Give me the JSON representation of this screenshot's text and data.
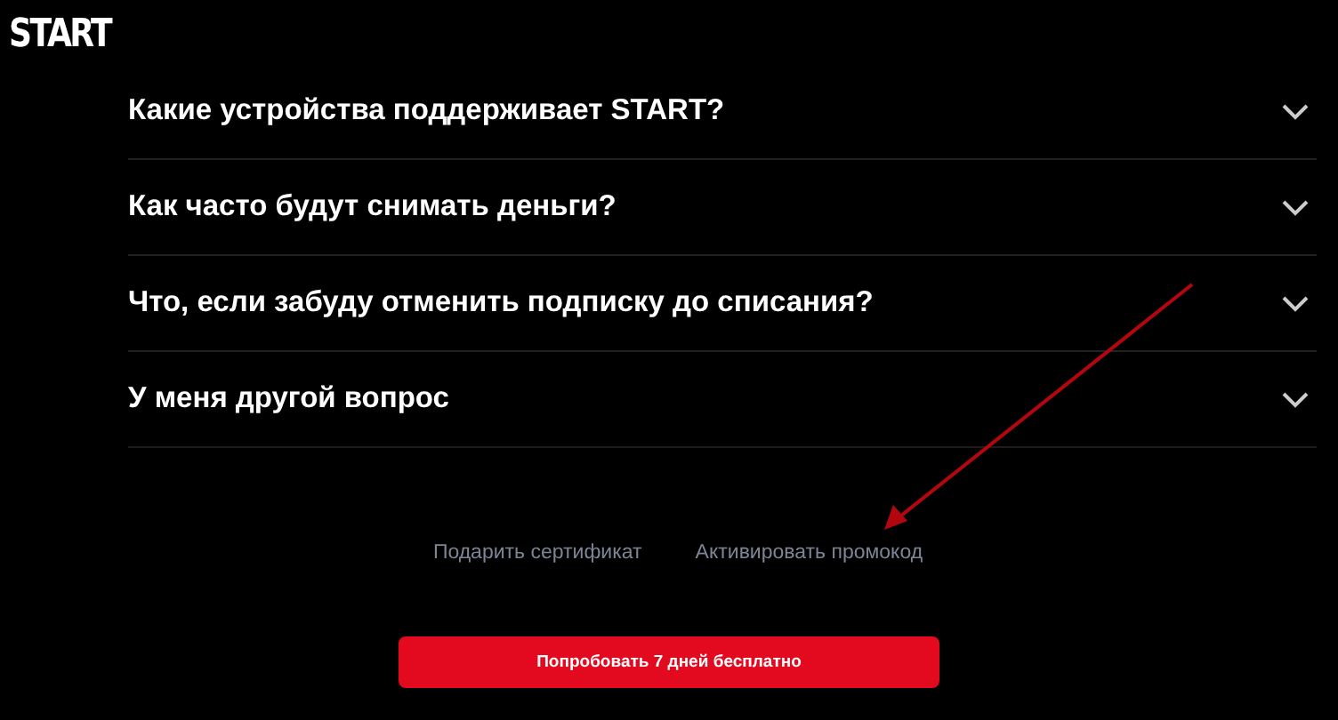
{
  "logo": "START",
  "faq": [
    {
      "question": "Какие устройства поддерживает START?",
      "expanded": false
    },
    {
      "question": "Как часто будут снимать деньги?",
      "expanded": false
    },
    {
      "question": "Что, если забуду отменить подписку до списания?",
      "expanded": false
    },
    {
      "question": "У меня другой вопрос",
      "expanded": false
    }
  ],
  "links": [
    "Подарить сертификат",
    "Активировать промокод"
  ],
  "button": "Попробовать 7 дней бесплатно"
}
